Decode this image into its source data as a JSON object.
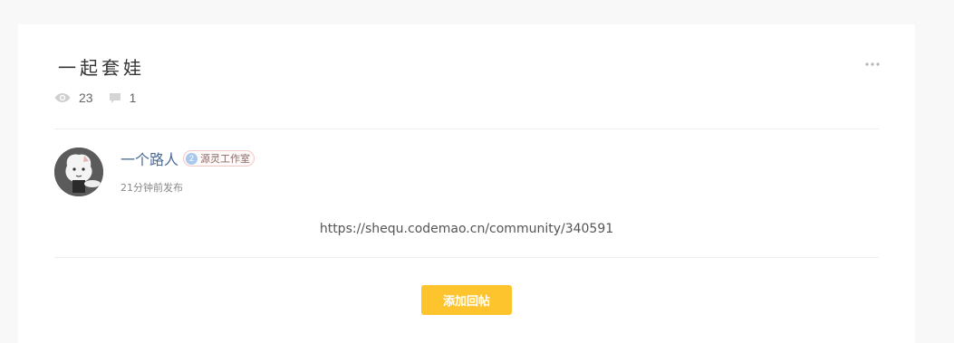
{
  "post": {
    "title": "一起套娃",
    "more_icon": "ellipsis-icon",
    "stats": {
      "views": "23",
      "views_icon": "eye-icon",
      "comments": "1",
      "comments_icon": "comment-icon"
    }
  },
  "author": {
    "name": "一个路人",
    "studio_badge_level": "2",
    "studio_name": "源灵工作室",
    "posted_time": "21分钟前发布"
  },
  "content": {
    "text": "https://shequ.codemao.cn/community/340591"
  },
  "actions": {
    "reply_label": "添加回帖"
  },
  "colors": {
    "accent": "#fec42d",
    "author_link": "#4a6a96",
    "badge_level_bg": "#a9c8ee",
    "badge_border": "#f0c9c6"
  }
}
